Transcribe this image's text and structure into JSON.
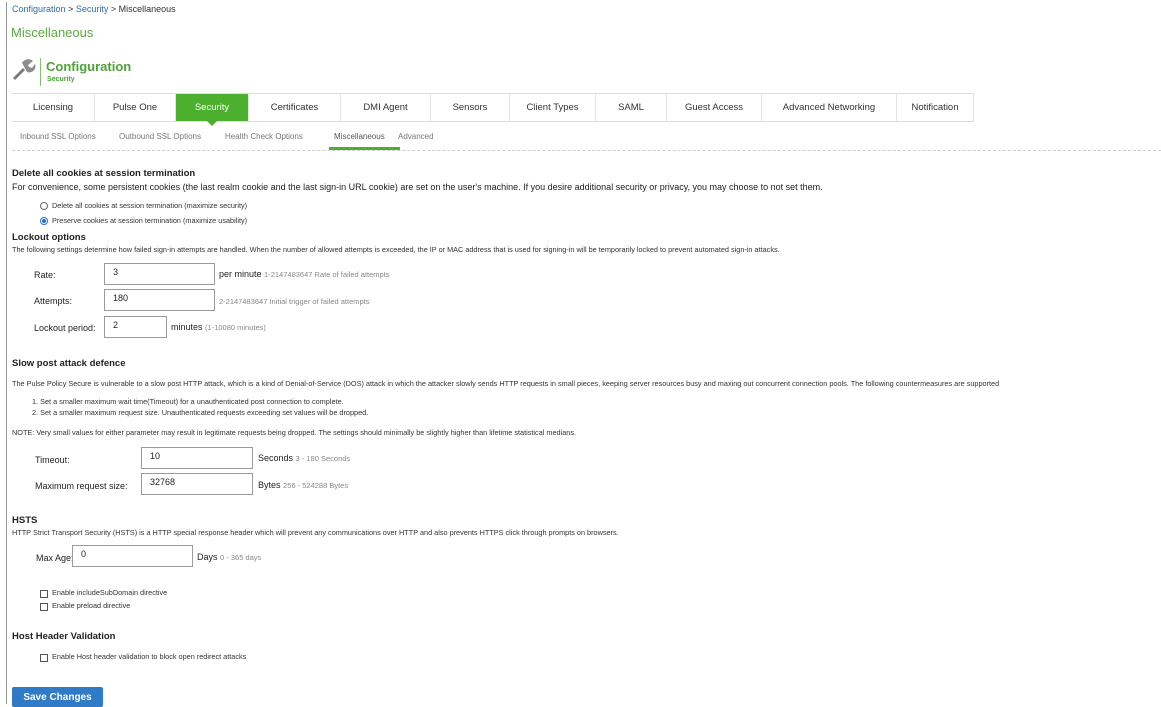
{
  "breadcrumb": {
    "part1": "Configuration",
    "sep1": " > ",
    "part2": "Security",
    "sep2": " > ",
    "current": "Miscellaneous"
  },
  "page_title": "Miscellaneous",
  "config_header": {
    "title": "Configuration",
    "subtitle": "Security",
    "icon": "wrench-icon"
  },
  "tabs": [
    {
      "label": "Licensing"
    },
    {
      "label": "Pulse One"
    },
    {
      "label": "Security"
    },
    {
      "label": "Certificates"
    },
    {
      "label": "DMI Agent"
    },
    {
      "label": "Sensors"
    },
    {
      "label": "Client Types"
    },
    {
      "label": "SAML"
    },
    {
      "label": "Guest Access"
    },
    {
      "label": "Advanced Networking"
    },
    {
      "label": "Notification"
    }
  ],
  "active_tab": "Security",
  "subtabs": [
    {
      "label": "Inbound SSL Options"
    },
    {
      "label": "Outbound SSL Options"
    },
    {
      "label": "Health Check Options"
    },
    {
      "label": "Miscellaneous"
    },
    {
      "label": "Advanced"
    }
  ],
  "active_subtab": "Miscellaneous",
  "cookies": {
    "heading": "Delete all cookies at session termination",
    "description": "For convenience, some persistent cookies (the last realm cookie and the last sign-in URL cookie) are set on the user's machine. If you desire additional security or privacy, you may choose to not set them.",
    "option_delete": "Delete all cookies at session termination (maximize security)",
    "option_preserve": "Preserve cookies at session termination (maximize usability)",
    "selected": "preserve"
  },
  "lockout": {
    "heading": "Lockout options",
    "description": "The following settings determine how failed sign-in attempts are handled. When the number of allowed attempts is exceeded, the IP or MAC address that is used for signing-in will be temporarily locked to prevent automated sign-in attacks.",
    "rate_label": "Rate:",
    "rate_value": "3",
    "rate_unit": "per minute",
    "rate_hint": "1-2147483647 Rate of failed attempts",
    "attempts_label": "Attempts:",
    "attempts_value": "180",
    "attempts_hint": "2-2147483647 Initial trigger of failed attempts",
    "period_label": "Lockout period:",
    "period_value": "2",
    "period_unit": "minutes",
    "period_hint": "(1-10080 minutes)"
  },
  "slowpost": {
    "heading": "Slow post attack defence",
    "description": "The Pulse Policy Secure is vulnerable to a slow post HTTP attack, which is a kind of Denial-of-Service (DOS) attack in which the attacker slowly sends HTTP requests in small pieces, keeping server resources busy and maxing out concurrent connection pools. The following countermeasures are supported",
    "item1": "1. Set a smaller maximum wait time(Timeout) for a unauthenticated post connection to complete.",
    "item2": "2. Set a smaller maximum request size. Unauthenticated requests exceeding set values will be dropped.",
    "note": "NOTE: Very small values for either parameter may result in legitimate requests being dropped. The settings should minimally be slightly higher than lifetime statistical medians.",
    "timeout_label": "Timeout:",
    "timeout_value": "10",
    "timeout_unit": "Seconds",
    "timeout_hint": "3 - 180 Seconds",
    "maxreq_label": "Maximum request size:",
    "maxreq_value": "32768",
    "maxreq_unit": "Bytes",
    "maxreq_hint": "256 - 524288 Bytes"
  },
  "hsts": {
    "heading": "HSTS",
    "description": "HTTP Strict Transport Security (HSTS) is a HTTP special response header which will prevent any communications over HTTP and also prevents HTTPS click through prompts on browsers.",
    "maxage_label": "Max Age:",
    "maxage_value": "0",
    "maxage_unit": "Days",
    "maxage_hint": "0 - 365 days",
    "include_subdomain": "Enable includeSubDomain directive",
    "preload": "Enable preload directive"
  },
  "host_header": {
    "heading": "Host Header Validation",
    "option": "Enable Host header validation to block open redirect attacks"
  },
  "save_button": "Save Changes"
}
